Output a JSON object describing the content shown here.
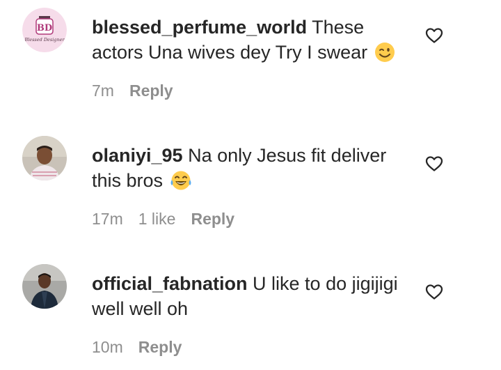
{
  "comments": [
    {
      "username": "blessed_perfume_world",
      "text": "These actors Una wives dey Try I swear",
      "emoji": "winking-face",
      "time": "7m",
      "likes": "",
      "reply_label": "Reply",
      "avatar_logo_text": "BD",
      "avatar_logo_caption": "Blessed Designer"
    },
    {
      "username": "olaniyi_95",
      "text": "Na only Jesus fit deliver this bros",
      "emoji": "face-with-tears-of-joy",
      "time": "17m",
      "likes": "1 like",
      "reply_label": "Reply"
    },
    {
      "username": "official_fabnation",
      "text": "U like to do jigijigi well well oh",
      "emoji": "",
      "time": "10m",
      "likes": "",
      "reply_label": "Reply"
    }
  ],
  "colors": {
    "text": "#262626",
    "secondary": "#8e8e8e",
    "logo_pink": "#f3d3e6",
    "logo_accent": "#b03a7a"
  },
  "icons": {
    "like": "heart-outline-icon"
  }
}
